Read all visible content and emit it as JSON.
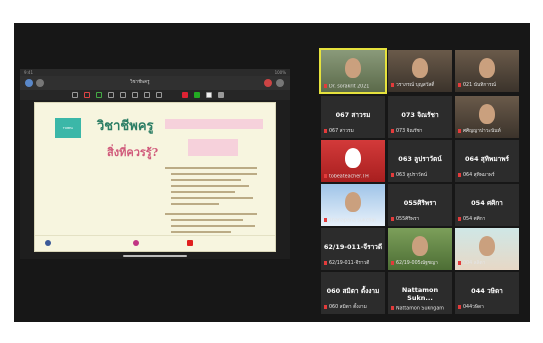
{
  "shared_screen": {
    "title": "วิชาชีพครู",
    "subtitle": "สิ่งที่ควรรู้?"
  },
  "participants": [
    {
      "name": "",
      "label": "Dr. sorakrit 2021",
      "video": true,
      "active": true
    },
    {
      "name": "",
      "label": "วราภรณ์ บุญสวัสดิ์",
      "video": true
    },
    {
      "name": "",
      "label": "021 นันทิการณ์",
      "video": true
    },
    {
      "name": "067 สาวรม",
      "label": "067 สาวรม",
      "video": false
    },
    {
      "name": "073 จิณรัชา",
      "label": "073 จิณรัชา",
      "video": false
    },
    {
      "name": "",
      "label": "ศศิญญาปาวะนันท์",
      "video": true
    },
    {
      "name": "",
      "label": "tobeateacher.TH",
      "video": true,
      "red": true
    },
    {
      "name": "063 ลูปราวัตน์",
      "label": "063 ลูปราวัตน์",
      "video": false
    },
    {
      "name": "064 สุทิพมาพร์",
      "label": "064 สุทิพมาพร์",
      "video": false
    },
    {
      "name": "",
      "label": "Thanapana sukchai",
      "video": true,
      "sky": true
    },
    {
      "name": "055ศิริพรา",
      "label": "055ศิริพรา",
      "video": false
    },
    {
      "name": "054 ศศิกา",
      "label": "054 ศศิกา",
      "video": false
    },
    {
      "name": "62/19-011-จีราวดี",
      "label": "62/19-011-จีราวดี",
      "video": false
    },
    {
      "name": "",
      "label": "62/19-005ณัฐชญา",
      "video": true,
      "green": true
    },
    {
      "name": "",
      "label": "004 ลลิตา",
      "video": true,
      "girl": true
    },
    {
      "name": "060 สมิตา ตั้งงาม",
      "label": "060 สมิตา ตั้งงาม",
      "video": false
    },
    {
      "name": "Nattamon Sukn...",
      "label": "Nattamon Sukngam",
      "video": false
    },
    {
      "name": "044 วษิดา",
      "label": "044วษิดา",
      "video": false
    }
  ]
}
